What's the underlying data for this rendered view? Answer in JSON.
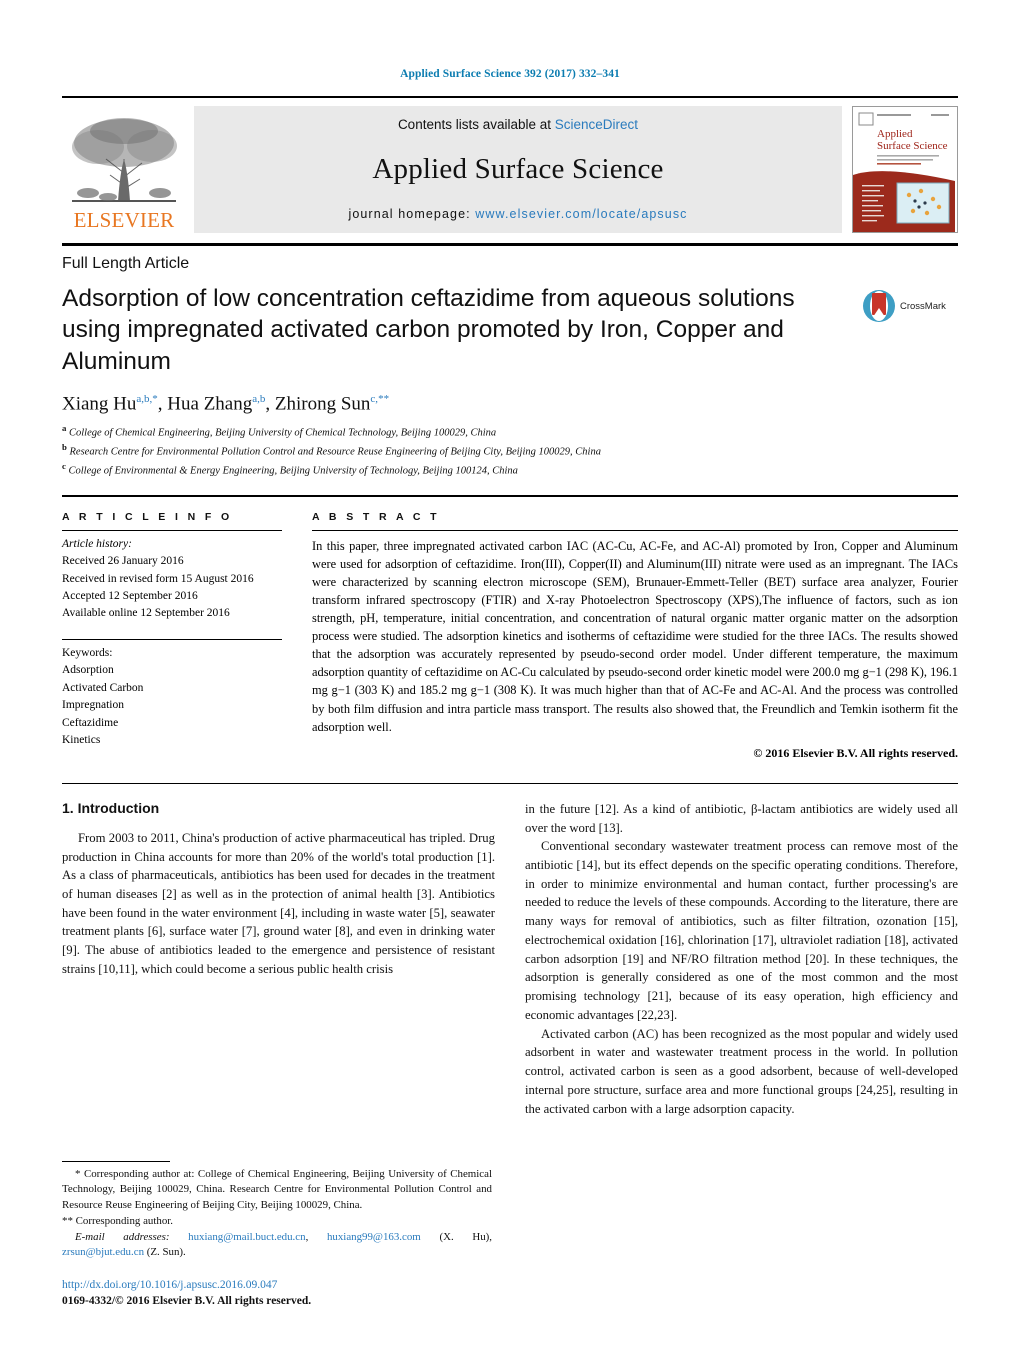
{
  "running_head": "Applied Surface Science 392 (2017) 332–341",
  "masthead": {
    "publisher": "ELSEVIER",
    "contents_prefix": "Contents lists available at ",
    "contents_link": "ScienceDirect",
    "journal_name": "Applied Surface Science",
    "homepage_prefix": "journal homepage: ",
    "homepage_url": "www.elsevier.com/locate/apsusc",
    "cover_title_line1": "Applied",
    "cover_title_line2": "Surface Science"
  },
  "article": {
    "type": "Full Length Article",
    "title": "Adsorption of low concentration ceftazidime from aqueous solutions using impregnated activated carbon promoted by Iron, Copper and Aluminum",
    "crossmark_label": "CrossMark",
    "authors_html": "Xiang Hu<sup>a,b,</sup><sup>*</sup>, Hua Zhang<sup>a,b</sup>, Zhirong Sun<sup>c,</sup><sup>**</sup>",
    "affiliations": [
      "College of Chemical Engineering, Beijing University of Chemical Technology, Beijing 100029, China",
      "Research Centre for Environmental Pollution Control and Resource Reuse Engineering of Beijing City, Beijing 100029, China",
      "College of Environmental & Energy Engineering, Beijing University of Technology, Beijing 100124, China"
    ],
    "affiliation_marks": [
      "a",
      "b",
      "c"
    ]
  },
  "article_info": {
    "heading": "A R T I C L E   I N F O",
    "history_label": "Article history:",
    "history": [
      "Received 26 January 2016",
      "Received in revised form 15 August 2016",
      "Accepted 12 September 2016",
      "Available online 12 September 2016"
    ],
    "keywords_label": "Keywords:",
    "keywords": [
      "Adsorption",
      "Activated Carbon",
      "Impregnation",
      "Ceftazidime",
      "Kinetics"
    ]
  },
  "abstract": {
    "heading": "A B S T R A C T",
    "text": "In this paper, three impregnated activated carbon IAC (AC-Cu, AC-Fe, and AC-Al) promoted by Iron, Copper and Aluminum were used for adsorption of ceftazidime. Iron(III), Copper(II) and Aluminum(III) nitrate were used as an impregnant. The IACs were characterized by scanning electron microscope (SEM), Brunauer-Emmett-Teller (BET) surface area analyzer, Fourier transform infrared spectroscopy (FTIR) and X-ray Photoelectron Spectroscopy (XPS),The influence of factors, such as ion strength, pH, temperature, initial concentration, and concentration of natural organic matter organic matter on the adsorption process were studied. The adsorption kinetics and isotherms of ceftazidime were studied for the three IACs. The results showed that the adsorption was accurately represented by pseudo-second order model. Under different temperature, the maximum adsorption quantity of ceftazidime on AC-Cu calculated by pseudo-second order kinetic model were 200.0 mg g−1 (298 K), 196.1 mg g−1 (303 K) and 185.2 mg g−1 (308 K). It was much higher than that of AC-Fe and AC-Al. And the process was controlled by both film diffusion and intra particle mass transport. The results also showed that, the Freundlich and Temkin isotherm fit the adsorption well.",
    "copyright": "© 2016 Elsevier B.V. All rights reserved."
  },
  "body": {
    "section_heading": "1.  Introduction",
    "left_paragraph_1": "From 2003 to 2011, China's production of active pharmaceutical has tripled. Drug production in China accounts for more than 20% of the world's total production [1]. As a class of pharmaceuticals, antibiotics has been used for decades in the treatment of human diseases [2] as well as in the protection of animal health [3]. Antibiotics have been found in the water environment [4], including in waste water [5], seawater treatment plants [6], surface water [7], ground water [8], and even in drinking water [9]. The abuse of antibiotics leaded to the emergence and persistence of resistant strains [10,11], which could become a serious public health crisis",
    "right_paragraph_1_cont": "in the future [12]. As a kind of antibiotic, β-lactam antibiotics are widely used all over the word [13].",
    "right_paragraph_2": "Conventional secondary wastewater treatment process can remove most of the antibiotic [14], but its effect depends on the specific operating conditions. Therefore, in order to minimize environmental and human contact, further processing's are needed to reduce the levels of these compounds. According to the literature, there are many ways for removal of antibiotics, such as filter filtration, ozonation [15], electrochemical oxidation [16], chlorination [17], ultraviolet radiation [18], activated carbon adsorption [19] and NF/RO filtration method [20]. In these techniques, the adsorption is generally considered as one of the most common and the most promising technology [21], because of its easy operation, high efficiency and economic advantages [22,23].",
    "right_paragraph_3": "Activated carbon (AC) has been recognized as the most popular and widely used adsorbent in water and wastewater treatment process in the world. In pollution control, activated carbon is seen as a good adsorbent, because of well-developed internal pore structure, surface area and more functional groups [24,25], resulting in the activated carbon with a large adsorption capacity."
  },
  "footnotes": {
    "corresponding_1": "* Corresponding author at: College of Chemical Engineering, Beijing University of Chemical Technology, Beijing 100029, China. Research Centre for Environmental Pollution Control and Resource Reuse Engineering of Beijing City, Beijing 100029, China.",
    "corresponding_2": "** Corresponding author.",
    "email_label": "E-mail addresses:",
    "email_1": "huxiang@mail.buct.edu.cn",
    "email_2": "huxiang99@163.com",
    "email_1_owner": "(X. Hu),",
    "email_3": "zrsun@bjut.edu.cn",
    "email_3_owner": "(Z. Sun)."
  },
  "doc_footer": {
    "doi": "http://dx.doi.org/10.1016/j.apsusc.2016.09.047",
    "issn": "0169-4332/© 2016 Elsevier B.V. All rights reserved."
  },
  "colors": {
    "link": "#2a7bbd",
    "runhead": "#0b7cb0",
    "elsevier_orange": "#E87722",
    "band_gray": "#e9e9e9"
  }
}
